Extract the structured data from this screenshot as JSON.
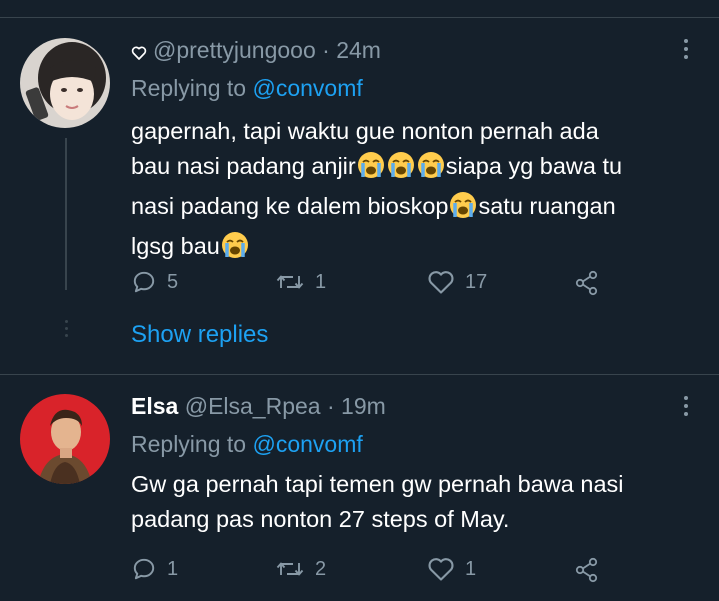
{
  "tweets": [
    {
      "badge_icon": "heart-outline-icon",
      "display_name": "",
      "handle": "@prettyjungooo",
      "separator": "·",
      "time": "24m",
      "replying_prefix": "Replying to",
      "replying_to": "@convomf",
      "text_lines": [
        [
          "gapernah, tapi waktu gue nonton pernah ada"
        ],
        [
          "bau nasi padang anjir",
          "😭",
          "😭",
          "😭",
          "siapa yg bawa tu"
        ],
        [
          "nasi padang ke dalem bioskop",
          "😭",
          "satu ruangan"
        ],
        [
          "lgsg bau",
          "😭"
        ]
      ],
      "reply_count": "5",
      "retweet_count": "1",
      "like_count": "17",
      "show_replies_label": "Show replies"
    },
    {
      "display_name": "Elsa",
      "handle": "@Elsa_Rpea",
      "separator": "·",
      "time": "19m",
      "replying_prefix": "Replying to",
      "replying_to": "@convomf",
      "text_lines": [
        [
          "Gw ga pernah tapi temen gw pernah bawa nasi"
        ],
        [
          "padang pas nonton 27 steps of May."
        ]
      ],
      "reply_count": "1",
      "retweet_count": "2",
      "like_count": "1"
    }
  ],
  "colors": {
    "background": "#15202b",
    "divider": "#38444d",
    "secondary_text": "#8899a6",
    "link": "#1da1f2"
  }
}
